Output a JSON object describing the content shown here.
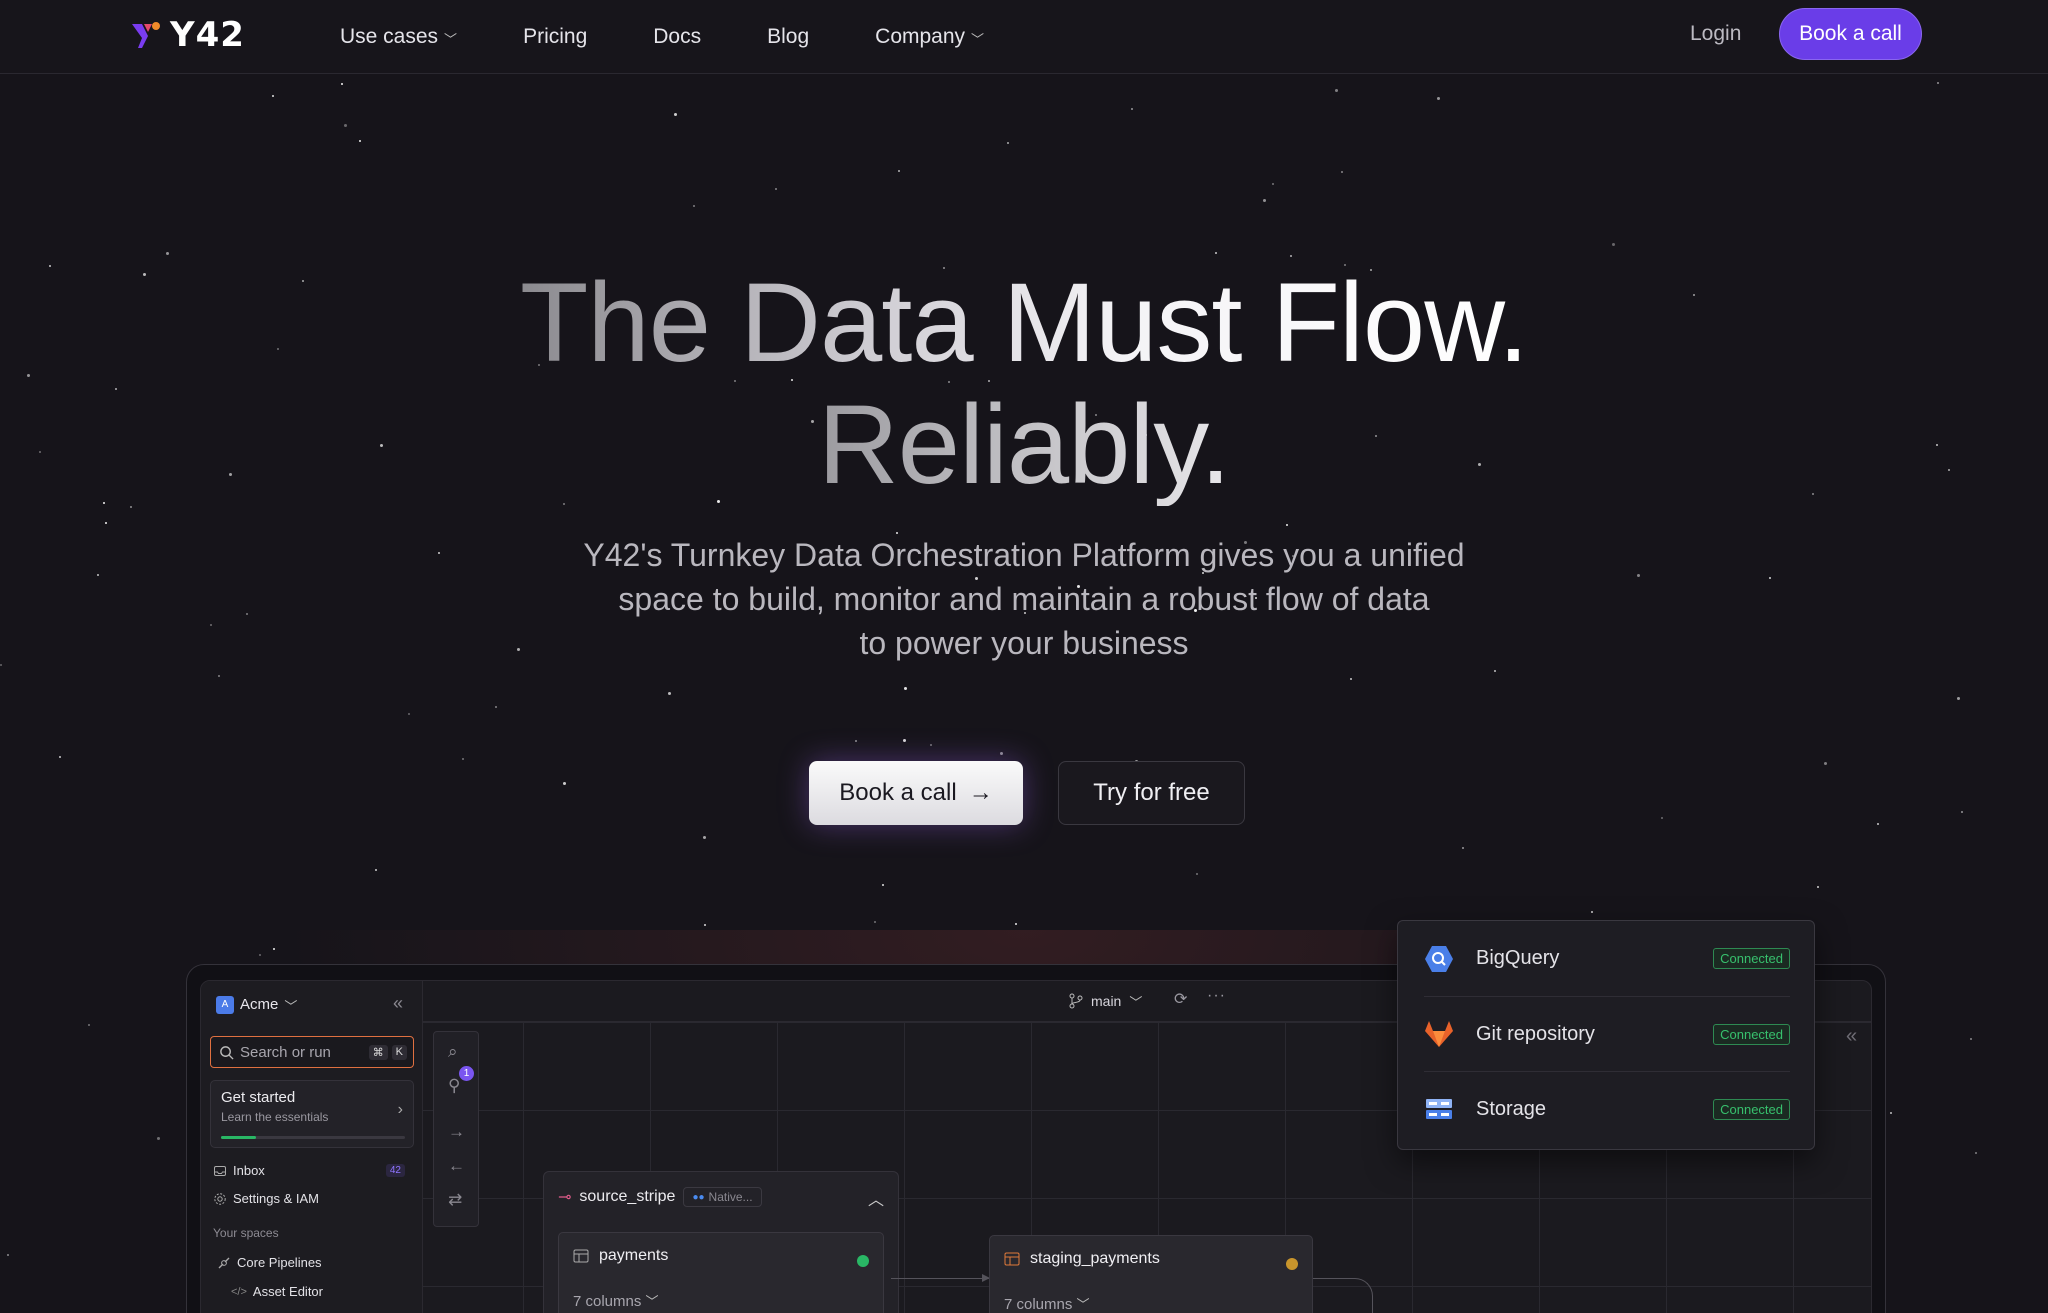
{
  "nav": {
    "logo_text": "Y42",
    "links": [
      "Use cases",
      "Pricing",
      "Docs",
      "Blog",
      "Company"
    ],
    "login": "Login",
    "cta": "Book a call"
  },
  "hero": {
    "title_line1": "The Data Must Flow.",
    "title_line2": "Reliably.",
    "subtitle_line1": "Y42's Turnkey Data Orchestration Platform gives you a unified",
    "subtitle_line2": "space to build, monitor and maintain a robust flow of data",
    "subtitle_line3": "to power your business",
    "primary_cta": "Book a call",
    "primary_cta_arrow": "→",
    "secondary_cta": "Try for free"
  },
  "app": {
    "workspace": "Acme",
    "workspace_badge": "A",
    "search_placeholder": "Search or run",
    "search_shortcut": [
      "⌘",
      "K"
    ],
    "get_started_title": "Get started",
    "get_started_sub": "Learn the essentials",
    "get_started_progress": 0.19,
    "inbox_label": "Inbox",
    "inbox_count": "42",
    "settings_label": "Settings & IAM",
    "spaces_label": "Your spaces",
    "space_item": "Core Pipelines",
    "space_sub_item": "Asset Editor",
    "filter_badge": "1",
    "branch": "main",
    "source_node": "source_stripe",
    "source_pill": "Native...",
    "payments_node": "payments",
    "payments_cols": "7 columns",
    "staging_node": "staging_payments",
    "staging_cols": "7 columns"
  },
  "connections": [
    {
      "name": "BigQuery",
      "status": "Connected",
      "icon": "bigquery-icon"
    },
    {
      "name": "Git repository",
      "status": "Connected",
      "icon": "gitlab-icon"
    },
    {
      "name": "Storage",
      "status": "Connected",
      "icon": "storage-icon"
    }
  ],
  "colors": {
    "accent": "#6a3de8",
    "background": "#16141a",
    "connected": "#37c06d",
    "status_green": "#29b765",
    "status_amber": "#c8952c"
  }
}
